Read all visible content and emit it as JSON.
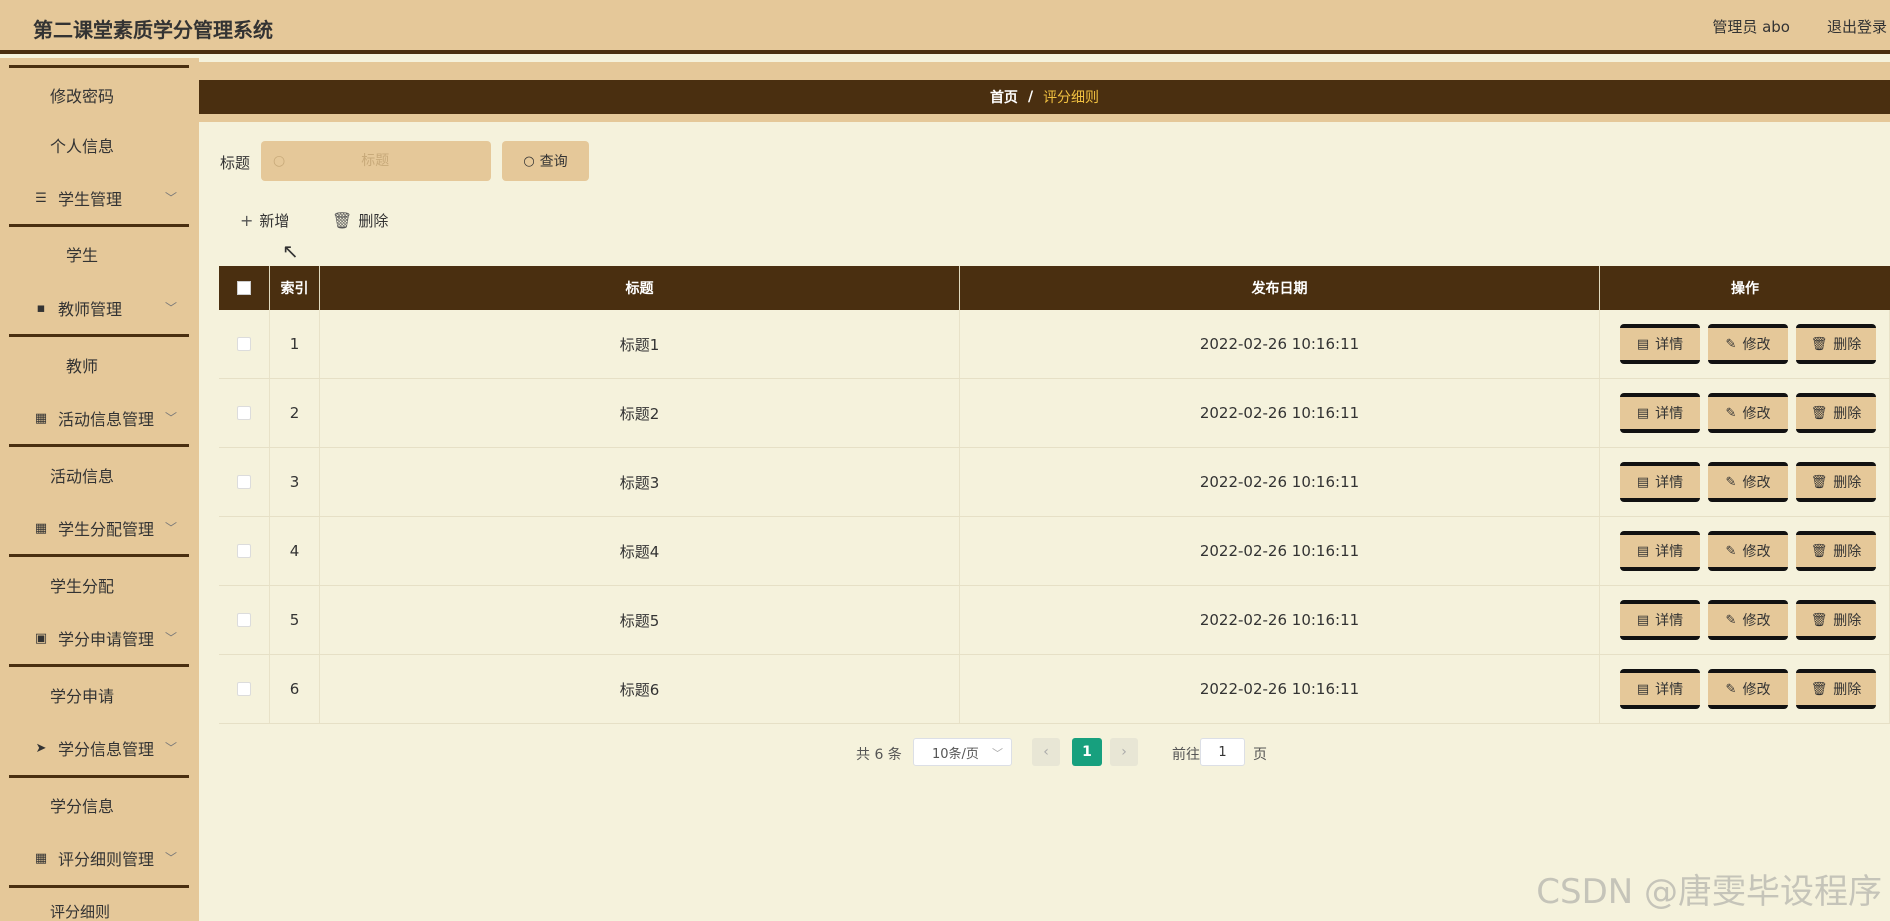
{
  "app": {
    "title": "第二课堂素质学分管理系统",
    "admin": "管理员 abo",
    "logout": "退出登录"
  },
  "sidebar": {
    "items": [
      {
        "label": "修改密码"
      },
      {
        "label": "个人信息"
      },
      {
        "label": "学生管理",
        "icon": "list-icon"
      },
      {
        "label": "学生"
      },
      {
        "label": "教师管理",
        "icon": "chat-icon"
      },
      {
        "label": "教师"
      },
      {
        "label": "活动信息管理",
        "icon": "grid-icon"
      },
      {
        "label": "活动信息"
      },
      {
        "label": "学生分配管理",
        "icon": "grid-icon"
      },
      {
        "label": "学生分配"
      },
      {
        "label": "学分申请管理",
        "icon": "clipboard-icon"
      },
      {
        "label": "学分申请"
      },
      {
        "label": "学分信息管理",
        "icon": "send-icon"
      },
      {
        "label": "学分信息"
      },
      {
        "label": "评分细则管理",
        "icon": "grid-icon"
      },
      {
        "label": "评分细则"
      }
    ]
  },
  "breadcrumb": {
    "home": "首页",
    "separator": "/",
    "current": "评分细则"
  },
  "search": {
    "label": "标题",
    "placeholder": "标题",
    "button": "查询"
  },
  "toolbar": {
    "add": "新增",
    "delete": "删除"
  },
  "table": {
    "headers": {
      "index": "索引",
      "title": "标题",
      "date": "发布日期",
      "ops": "操作"
    },
    "rows": [
      {
        "index": "1",
        "title": "标题1",
        "date": "2022-02-26 10:16:11"
      },
      {
        "index": "2",
        "title": "标题2",
        "date": "2022-02-26 10:16:11"
      },
      {
        "index": "3",
        "title": "标题3",
        "date": "2022-02-26 10:16:11"
      },
      {
        "index": "4",
        "title": "标题4",
        "date": "2022-02-26 10:16:11"
      },
      {
        "index": "5",
        "title": "标题5",
        "date": "2022-02-26 10:16:11"
      },
      {
        "index": "6",
        "title": "标题6",
        "date": "2022-02-26 10:16:11"
      }
    ],
    "actions": {
      "view": "详情",
      "edit": "修改",
      "delete": "删除"
    }
  },
  "pagination": {
    "total": "共 6 条",
    "page_size": "10条/页",
    "current_page": "1",
    "goto_label": "前往",
    "goto_value": "1",
    "page_suffix": "页"
  },
  "watermark": "CSDN @唐雯毕设程序",
  "colors": {
    "header_bg": "#e5c899",
    "dark_brown": "#4a2f10",
    "content_bg": "#f5f2dc",
    "active_page": "#17a07e",
    "breadcrumb_current": "#f0c040"
  }
}
